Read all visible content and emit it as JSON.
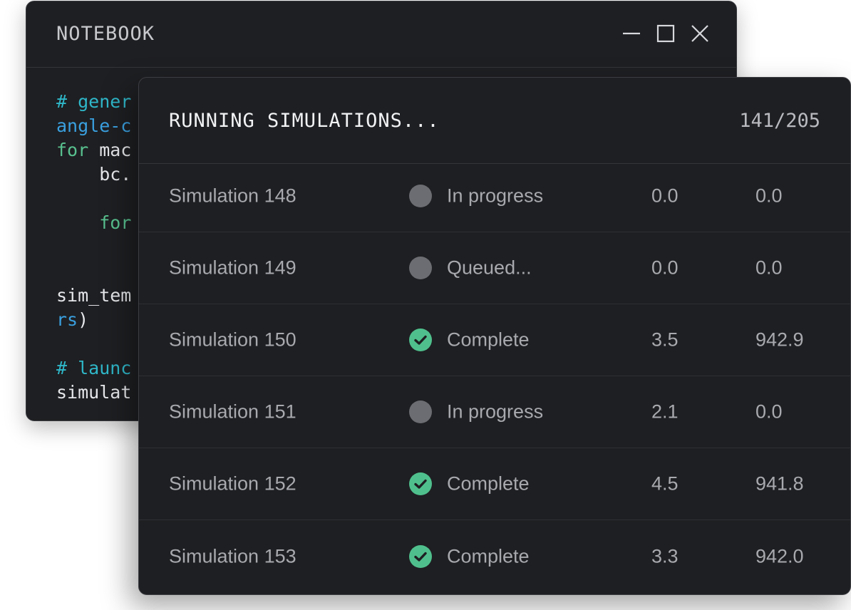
{
  "notebook": {
    "title": "NOTEBOOK",
    "code_lines": [
      [
        {
          "text": "# gener",
          "cls": "c-comment"
        }
      ],
      [
        {
          "text": "angle-c",
          "cls": "c-ident-blue"
        }
      ],
      [
        {
          "text": "for",
          "cls": "c-kw"
        },
        {
          "text": " mac",
          "cls": "c-plain"
        }
      ],
      [
        {
          "text": "    bc.",
          "cls": "c-plain"
        }
      ],
      [
        {
          "text": "",
          "cls": "c-plain"
        }
      ],
      [
        {
          "text": "    for",
          "cls": "c-kw"
        }
      ],
      [
        {
          "text": "",
          "cls": "c-plain"
        }
      ],
      [
        {
          "text": "",
          "cls": "c-plain"
        }
      ],
      [
        {
          "text": "sim_tem",
          "cls": "c-plain"
        }
      ],
      [
        {
          "text": "rs",
          "cls": "c-ident-blue"
        },
        {
          "text": ")",
          "cls": "c-plain"
        }
      ],
      [
        {
          "text": "",
          "cls": "c-plain"
        }
      ],
      [
        {
          "text": "# launc",
          "cls": "c-comment"
        }
      ],
      [
        {
          "text": "simulat",
          "cls": "c-plain"
        }
      ]
    ]
  },
  "simulations": {
    "title": "RUNNING SIMULATIONS...",
    "progress": "141/205",
    "rows": [
      {
        "name": "Simulation 148",
        "status": "In progress",
        "status_icon": "grey-dot-icon",
        "v1": "0.0",
        "v2": "0.0"
      },
      {
        "name": "Simulation 149",
        "status": "Queued...",
        "status_icon": "grey-dot-icon",
        "v1": "0.0",
        "v2": "0.0"
      },
      {
        "name": "Simulation 150",
        "status": "Complete",
        "status_icon": "check-circle-icon",
        "v1": "3.5",
        "v2": "942.9"
      },
      {
        "name": "Simulation 151",
        "status": "In progress",
        "status_icon": "grey-dot-icon",
        "v1": "2.1",
        "v2": "0.0"
      },
      {
        "name": "Simulation 152",
        "status": "Complete",
        "status_icon": "check-circle-icon",
        "v1": "4.5",
        "v2": "941.8"
      },
      {
        "name": "Simulation 153",
        "status": "Complete",
        "status_icon": "check-circle-icon",
        "v1": "3.3",
        "v2": "942.0"
      }
    ]
  },
  "colors": {
    "window_bg": "#1e1f22",
    "complete_green": "#4fc08d",
    "pending_grey": "#6c6d72",
    "comment_cyan": "#2fb7c9",
    "keyword_green": "#58c08f",
    "identifier_blue": "#3aa0e0"
  }
}
